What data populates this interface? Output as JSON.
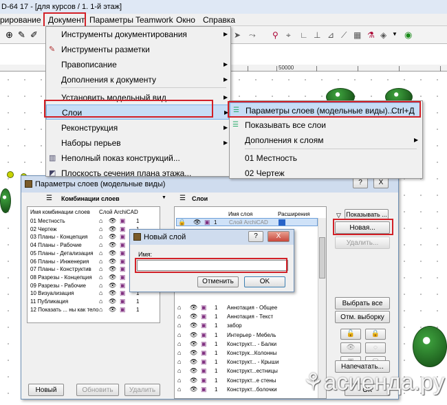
{
  "window": {
    "title": "D-64 17 - [для курсов / 1. 1-й этаж]"
  },
  "menubar": {
    "items": [
      "рирование",
      "Документ",
      "Параметры",
      "Teamwork",
      "Окно",
      "Справка"
    ]
  },
  "ruler": {
    "label": "50000"
  },
  "doc_menu": {
    "items": [
      {
        "label": "Инструменты документирования",
        "has_sub": true
      },
      {
        "label": "Инструменты разметки",
        "has_sub": false
      },
      {
        "label": "Правописание",
        "has_sub": true
      },
      {
        "label": "Дополнения к документу",
        "has_sub": true
      },
      {
        "label": "Установить модельный вид",
        "has_sub": true
      },
      {
        "label": "Слои",
        "has_sub": true
      },
      {
        "label": "Реконструкция",
        "has_sub": true
      },
      {
        "label": "Наборы перьев",
        "has_sub": true
      },
      {
        "label": "Неполный показ конструкций...",
        "has_sub": false
      },
      {
        "label": "Плоскость сечения плана этажа...",
        "has_sub": false
      }
    ]
  },
  "layers_submenu": {
    "items": [
      {
        "label": "Параметры слоев (модельные виды)...",
        "shortcut": "Ctrl+Д"
      },
      {
        "label": "Показывать все слои",
        "shortcut": ""
      },
      {
        "label": "Дополнения к слоям",
        "shortcut": ""
      },
      {
        "label": "01 Местность",
        "shortcut": ""
      },
      {
        "label": "02 Чертеж",
        "shortcut": ""
      }
    ]
  },
  "layer_dialog": {
    "title": "Параметры слоев (модельные виды)",
    "help": "?",
    "close": "X",
    "left_panel": {
      "title": "Комбинации слоев",
      "col_name": "Имя комбинации слоев",
      "col_archicad": "Слой ArchiCAD",
      "combos": [
        "01 Местность",
        "02 Чертеж",
        "03 Планы - Концепция",
        "04 Планы - Рабочие",
        "05 Планы - Детализация",
        "06 Планы - Инженерия",
        "07 Планы - Конструктив",
        "08 Разрезы - Концепция",
        "09 Разрезы - Рабочие",
        "10 Визуализация",
        "11 Публикация",
        "12 Показать ... ны как тело"
      ],
      "new_btn": "Новый",
      "update_btn": "Обновить",
      "delete_btn": "Удалить"
    },
    "right_panel": {
      "title": "Слои",
      "col_name": "Имя слоя",
      "col_ext": "Расширения",
      "first_layer": "Слой ArchiCAD",
      "layers": [
        "Аннотация - Общее",
        "Аннотация - Текст",
        "забор",
        "Интерьер - Мебель",
        "Конструкт... - Балки",
        "Конструк...Колонны",
        "Конструкт... - Крыши",
        "Конструкт...естницы",
        "Конструкт...е стены",
        "Конструкт...болочки"
      ],
      "layer_num": "1"
    },
    "show_btn": "Показывать ...",
    "new_layer_btn": "Новая...",
    "delete_layer_btn": "Удалить...",
    "select_all_btn": "Выбрать все",
    "deselect_btn": "Отм. выборку",
    "print_btn": "Напечатать...",
    "ok_btn": "ОК"
  },
  "new_layer_dialog": {
    "title": "Новый слой",
    "help": "?",
    "close": "X",
    "name_label": "Имя:",
    "name_value": "",
    "cancel_btn": "Отменить",
    "ok_btn": "OK"
  },
  "watermark": {
    "text": "асиенда.ру"
  }
}
